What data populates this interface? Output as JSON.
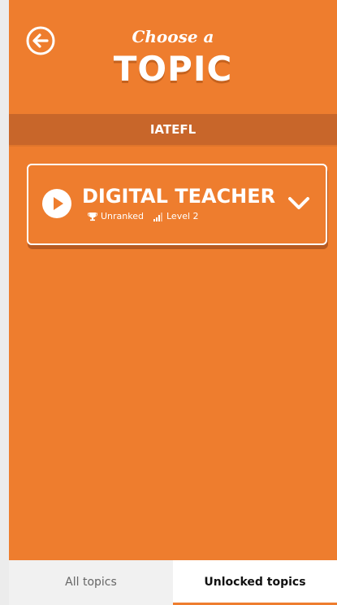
{
  "header": {
    "back_icon": "back-arrow-circle-icon",
    "title_small": "Choose a",
    "title_big": "TOPIC"
  },
  "section": {
    "label": "IATEFL"
  },
  "topic": {
    "title": "DIGITAL TEACHER",
    "rank_icon": "trophy-icon",
    "rank": "Unranked",
    "level_icon": "signal-bars-icon",
    "level": "Level 2",
    "play_icon": "play-circle-icon",
    "expand_icon": "chevron-down-icon"
  },
  "tabs": [
    {
      "label": "All topics",
      "active": false
    },
    {
      "label": "Unlocked topics",
      "active": true
    }
  ],
  "colors": {
    "accent": "#ee7d2e",
    "section_bar": "#c8662a",
    "background": "#ececec"
  }
}
